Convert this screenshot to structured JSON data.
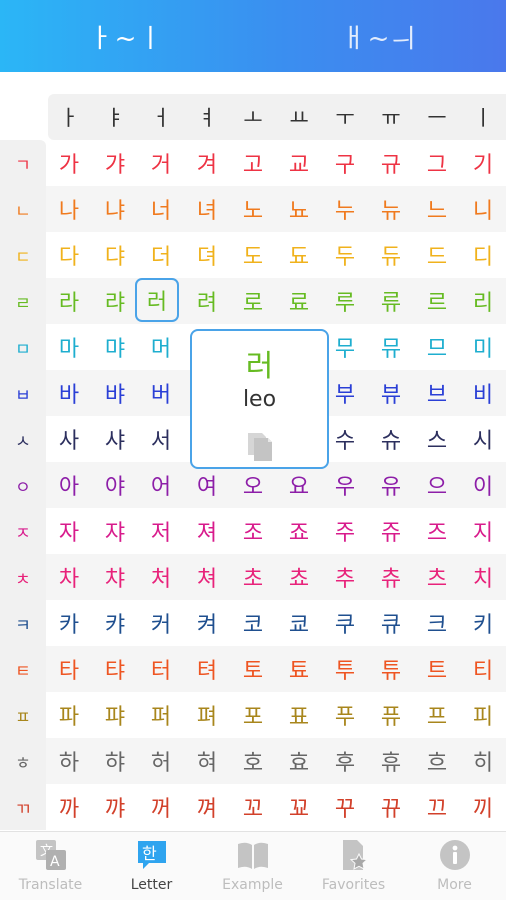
{
  "header": {
    "tab_left": "ㅏ~ㅣ",
    "tab_right": "ㅐ~ㅢ"
  },
  "colors": {
    "header_gradient": [
      "#2bb6f6",
      "#4a78ec"
    ],
    "selected_border": "#4aa3e8",
    "nav_active": "#2fa4ef",
    "nav_inactive": "#c4c4c4"
  },
  "vowels": [
    "ㅏ",
    "ㅑ",
    "ㅓ",
    "ㅕ",
    "ㅗ",
    "ㅛ",
    "ㅜ",
    "ㅠ",
    "ㅡ",
    "ㅣ"
  ],
  "consonants": [
    "ㄱ",
    "ㄴ",
    "ㄷ",
    "ㄹ",
    "ㅁ",
    "ㅂ",
    "ㅅ",
    "ㅇ",
    "ㅈ",
    "ㅊ",
    "ㅋ",
    "ㅌ",
    "ㅍ",
    "ㅎ",
    "ㄲ"
  ],
  "row_colors": [
    "#ee3344",
    "#f07a1e",
    "#f0b21c",
    "#66bb22",
    "#1eaecf",
    "#2a3fd6",
    "#2c2f5e",
    "#8d1ea8",
    "#d81b8c",
    "#e8227a",
    "#1f4f8f",
    "#ee5522",
    "#a8861c",
    "#666666",
    "#d2402a"
  ],
  "rows": [
    [
      "가",
      "갸",
      "거",
      "겨",
      "고",
      "교",
      "구",
      "규",
      "그",
      "기"
    ],
    [
      "나",
      "냐",
      "너",
      "녀",
      "노",
      "뇨",
      "누",
      "뉴",
      "느",
      "니"
    ],
    [
      "다",
      "댜",
      "더",
      "뎌",
      "도",
      "됴",
      "두",
      "듀",
      "드",
      "디"
    ],
    [
      "라",
      "랴",
      "러",
      "려",
      "로",
      "료",
      "루",
      "류",
      "르",
      "리"
    ],
    [
      "마",
      "먀",
      "머",
      "",
      "",
      "",
      "무",
      "뮤",
      "므",
      "미"
    ],
    [
      "바",
      "뱌",
      "버",
      "",
      "",
      "",
      "부",
      "뷰",
      "브",
      "비"
    ],
    [
      "사",
      "샤",
      "서",
      "",
      "",
      "",
      "수",
      "슈",
      "스",
      "시"
    ],
    [
      "아",
      "야",
      "어",
      "여",
      "오",
      "요",
      "우",
      "유",
      "으",
      "이"
    ],
    [
      "자",
      "쟈",
      "저",
      "져",
      "조",
      "죠",
      "주",
      "쥬",
      "즈",
      "지"
    ],
    [
      "차",
      "챠",
      "처",
      "쳐",
      "초",
      "쵸",
      "추",
      "츄",
      "츠",
      "치"
    ],
    [
      "카",
      "캬",
      "커",
      "켜",
      "코",
      "쿄",
      "쿠",
      "큐",
      "크",
      "키"
    ],
    [
      "타",
      "탸",
      "터",
      "텨",
      "토",
      "툐",
      "투",
      "튜",
      "트",
      "티"
    ],
    [
      "파",
      "퍄",
      "퍼",
      "펴",
      "포",
      "표",
      "푸",
      "퓨",
      "프",
      "피"
    ],
    [
      "하",
      "햐",
      "허",
      "혀",
      "호",
      "효",
      "후",
      "휴",
      "흐",
      "히"
    ],
    [
      "까",
      "꺄",
      "꺼",
      "껴",
      "꼬",
      "꾜",
      "꾸",
      "뀨",
      "끄",
      "끼"
    ]
  ],
  "selected": {
    "row": 3,
    "col": 2
  },
  "popup": {
    "character": "러",
    "romanization": "leo",
    "copy_icon": "copy-icon"
  },
  "nav": {
    "items": [
      {
        "label": "Translate",
        "icon": "translate-icon",
        "active": false
      },
      {
        "label": "Letter",
        "icon": "letter-icon",
        "active": true
      },
      {
        "label": "Example",
        "icon": "book-icon",
        "active": false
      },
      {
        "label": "Favorites",
        "icon": "favorites-icon",
        "active": false
      },
      {
        "label": "More",
        "icon": "info-icon",
        "active": false
      }
    ]
  }
}
